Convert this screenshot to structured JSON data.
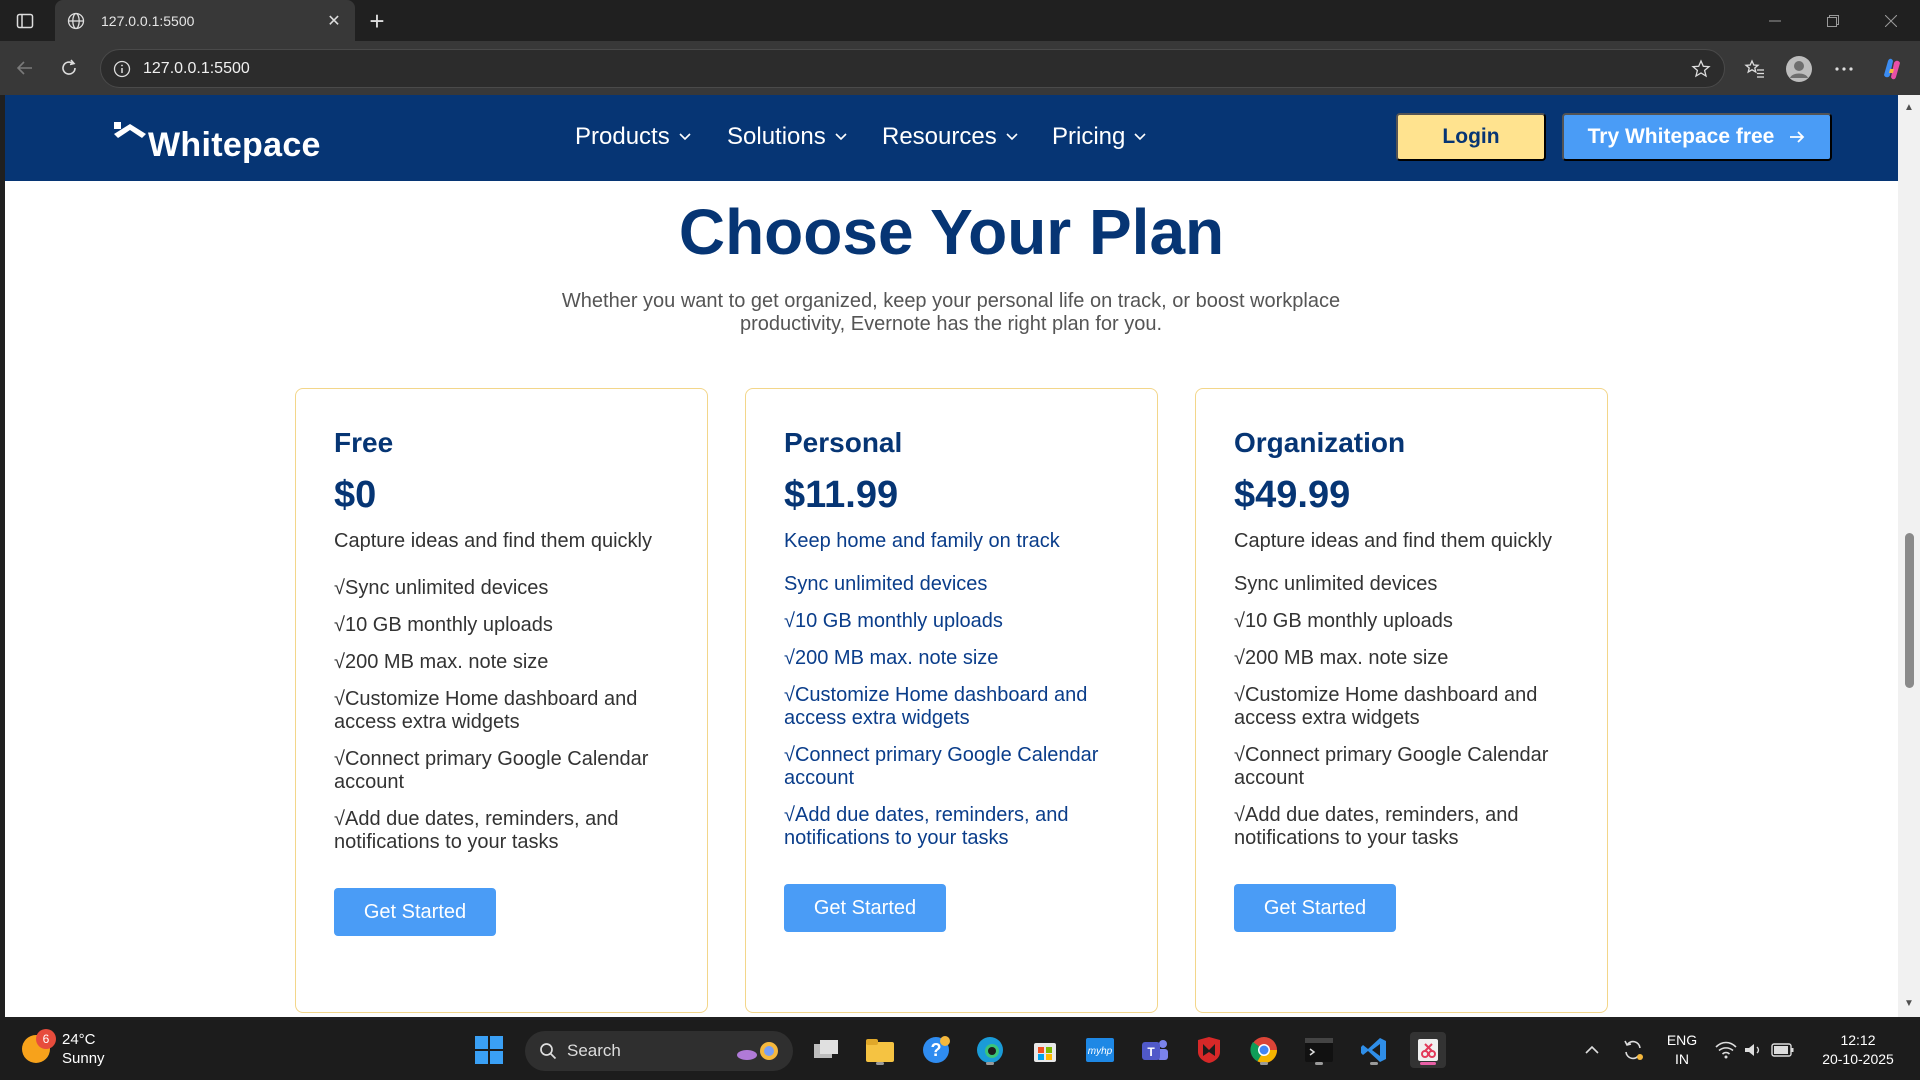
{
  "browser": {
    "tab_title": "127.0.0.1:5500",
    "url": "127.0.0.1:5500"
  },
  "site": {
    "logo_text": "Whitepace",
    "nav": [
      {
        "label": "Products"
      },
      {
        "label": "Solutions"
      },
      {
        "label": "Resources"
      },
      {
        "label": "Pricing"
      }
    ],
    "login_label": "Login",
    "try_label": "Try Whitepace free"
  },
  "hero": {
    "title": "Choose Your Plan",
    "subtitle": "Whether you want to get organized, keep your personal life on track, or boost workplace productivity, Evernote has the right plan for you."
  },
  "plans": [
    {
      "name": "Free",
      "price": "$0",
      "tagline": "Capture ideas and find them quickly",
      "features": [
        "√Sync unlimited devices",
        "√10 GB monthly uploads",
        "√200 MB max. note size",
        "√Customize Home dashboard and access extra widgets",
        "√Connect primary Google Calendar account",
        "√Add due dates, reminders, and notifications to your tasks"
      ],
      "cta": "Get Started"
    },
    {
      "name": "Personal",
      "price": "$11.99",
      "tagline": "Keep home and family on track",
      "features": [
        "Sync unlimited devices",
        "√10 GB monthly uploads",
        "√200 MB max. note size",
        "√Customize Home dashboard and access extra widgets",
        "√Connect primary Google Calendar account",
        "√Add due dates, reminders, and notifications to your tasks"
      ],
      "cta": "Get Started"
    },
    {
      "name": "Organization",
      "price": "$49.99",
      "tagline": "Capture ideas and find them quickly",
      "features": [
        "Sync unlimited devices",
        "√10 GB monthly uploads",
        "√200 MB max. note size",
        "√Customize Home dashboard and access extra widgets",
        "√Connect primary Google Calendar account",
        "√Add due dates, reminders, and notifications to your tasks"
      ],
      "cta": "Get Started"
    }
  ],
  "taskbar": {
    "weather_temp": "24°C",
    "weather_desc": "Sunny",
    "weather_badge": "6",
    "search_label": "Search",
    "lang_line1": "ENG",
    "lang_line2": "IN",
    "time": "12:12",
    "date": "20-10-2025"
  },
  "colors": {
    "brand_navy": "#063574",
    "accent_blue": "#4a9cf6",
    "login_yellow": "#ffe38f",
    "card_border": "#f3d68a"
  }
}
